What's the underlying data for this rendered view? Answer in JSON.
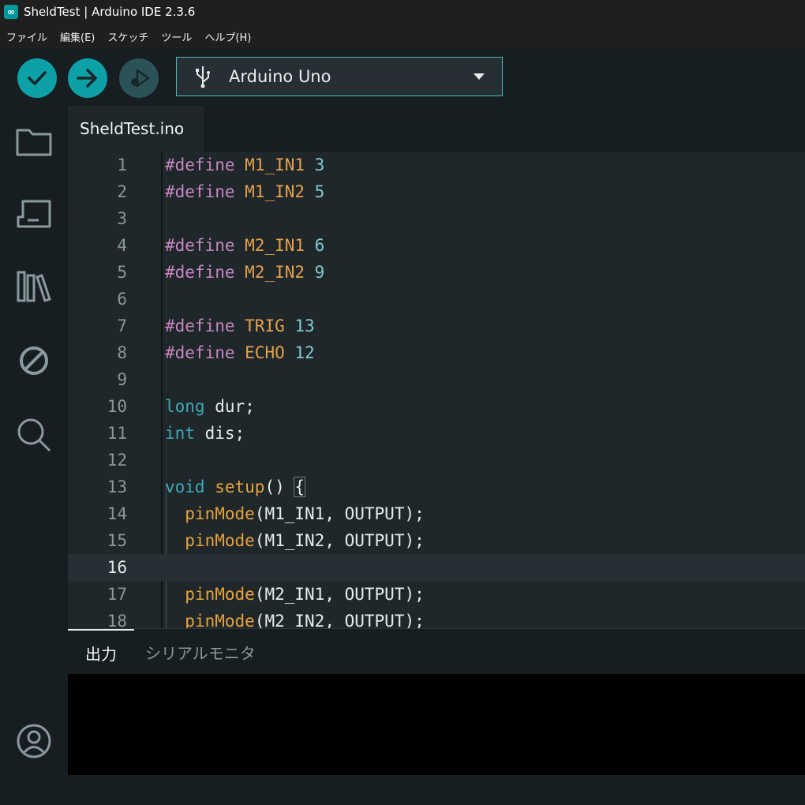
{
  "window": {
    "title": "SheldTest | Arduino IDE 2.3.6"
  },
  "menu": [
    "ファイル",
    "編集(E)",
    "スケッチ",
    "ツール",
    "ヘルプ(H)"
  ],
  "toolbar": {
    "verify_icon": "check-icon",
    "upload_icon": "arrow-right-icon",
    "debug_icon": "debug-icon",
    "board": {
      "name": "Arduino Uno",
      "icon": "usb-icon"
    }
  },
  "sidebar": [
    "folder-icon",
    "board-icon",
    "library-icon",
    "debug-disabled-icon",
    "search-icon",
    "account-icon"
  ],
  "editor": {
    "tab": "SheldTest.ino",
    "current_line": 16,
    "lines": [
      {
        "n": "1",
        "t": [
          [
            "#define ",
            "def"
          ],
          [
            "M1_IN1 ",
            "mac"
          ],
          [
            "3",
            "num"
          ]
        ]
      },
      {
        "n": "2",
        "t": [
          [
            "#define ",
            "def"
          ],
          [
            "M1_IN2 ",
            "mac"
          ],
          [
            "5",
            "num"
          ]
        ]
      },
      {
        "n": "3",
        "t": []
      },
      {
        "n": "4",
        "t": [
          [
            "#define ",
            "def"
          ],
          [
            "M2_IN1 ",
            "mac"
          ],
          [
            "6",
            "num"
          ]
        ]
      },
      {
        "n": "5",
        "t": [
          [
            "#define ",
            "def"
          ],
          [
            "M2_IN2 ",
            "mac"
          ],
          [
            "9",
            "num"
          ]
        ]
      },
      {
        "n": "6",
        "t": []
      },
      {
        "n": "7",
        "t": [
          [
            "#define ",
            "def"
          ],
          [
            "TRIG ",
            "mac"
          ],
          [
            "13",
            "num"
          ]
        ]
      },
      {
        "n": "8",
        "t": [
          [
            "#define ",
            "def"
          ],
          [
            "ECHO ",
            "mac"
          ],
          [
            "12",
            "num"
          ]
        ]
      },
      {
        "n": "9",
        "t": []
      },
      {
        "n": "10",
        "t": [
          [
            "long ",
            "type"
          ],
          [
            "dur;",
            "plain"
          ]
        ]
      },
      {
        "n": "11",
        "t": [
          [
            "int ",
            "type"
          ],
          [
            "dis;",
            "plain"
          ]
        ]
      },
      {
        "n": "12",
        "t": []
      },
      {
        "n": "13",
        "t": [
          [
            "void ",
            "type"
          ],
          [
            "setup",
            "fn"
          ],
          [
            "() ",
            "plain"
          ],
          [
            "{",
            "brace"
          ]
        ]
      },
      {
        "n": "14",
        "t": [
          [
            "  ",
            "plain"
          ],
          [
            "pinMode",
            "fn"
          ],
          [
            "(M1_IN1, OUTPUT);",
            "plain"
          ]
        ]
      },
      {
        "n": "15",
        "t": [
          [
            "  ",
            "plain"
          ],
          [
            "pinMode",
            "fn"
          ],
          [
            "(M1_IN2, OUTPUT);",
            "plain"
          ]
        ]
      },
      {
        "n": "16",
        "t": []
      },
      {
        "n": "17",
        "t": [
          [
            "  ",
            "plain"
          ],
          [
            "pinMode",
            "fn"
          ],
          [
            "(M2_IN1, OUTPUT);",
            "plain"
          ]
        ]
      },
      {
        "n": "18",
        "t": [
          [
            "  ",
            "plain"
          ],
          [
            "pinMode",
            "fn"
          ],
          [
            "(M2_IN2, OUTPUT);",
            "plain"
          ]
        ]
      }
    ]
  },
  "panel": {
    "tabs": [
      "出力",
      "シリアルモニタ"
    ],
    "active": 0
  }
}
